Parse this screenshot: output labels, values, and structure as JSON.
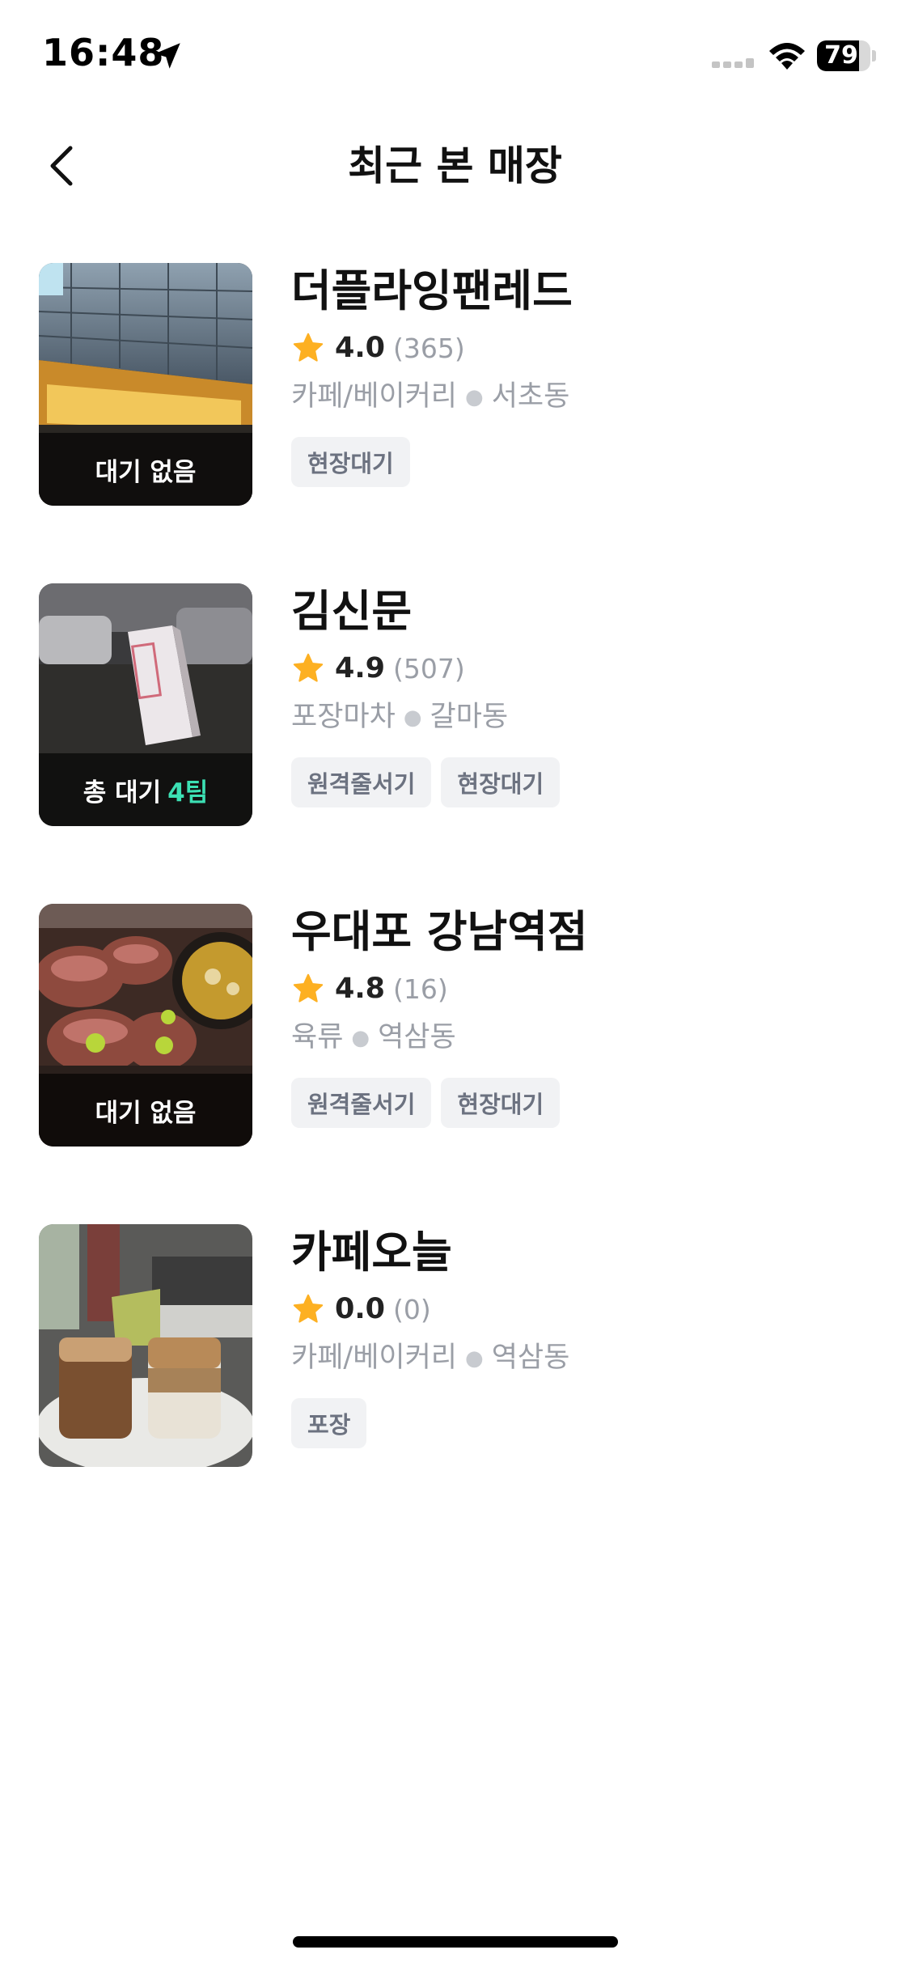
{
  "status_bar": {
    "time": "16:48",
    "battery_level": 79,
    "battery_text": "79",
    "icons": [
      "location-arrow-icon",
      "cellular-signal-icon",
      "wifi-icon",
      "battery-icon"
    ]
  },
  "header": {
    "title": "최근 본 매장",
    "back_icon": "chevron-left-icon"
  },
  "stores": [
    {
      "name": "더플라잉팬레드",
      "rating": "4.0",
      "reviews": "(365)",
      "category": "카페/베이커리",
      "area": "서초동",
      "wait_label": "대기 없음",
      "wait_count": "",
      "tags": [
        "현장대기"
      ]
    },
    {
      "name": "김신문",
      "rating": "4.9",
      "reviews": "(507)",
      "category": "포장마차",
      "area": "갈마동",
      "wait_label": "총 대기",
      "wait_count": "4팀",
      "tags": [
        "원격줄서기",
        "현장대기"
      ]
    },
    {
      "name": "우대포 강남역점",
      "rating": "4.8",
      "reviews": "(16)",
      "category": "육류",
      "area": "역삼동",
      "wait_label": "대기 없음",
      "wait_count": "",
      "tags": [
        "원격줄서기",
        "현장대기"
      ]
    },
    {
      "name": "카페오늘",
      "rating": "0.0",
      "reviews": "(0)",
      "category": "카페/베이커리",
      "area": "역삼동",
      "wait_label": "",
      "wait_count": "",
      "tags": [
        "포장"
      ]
    }
  ],
  "colors": {
    "star": "#FDB022",
    "wait_count": "#3CE0B4",
    "tag_bg": "#F1F2F4",
    "tag_text": "#6C7280",
    "muted_text": "#9A9EA6"
  }
}
